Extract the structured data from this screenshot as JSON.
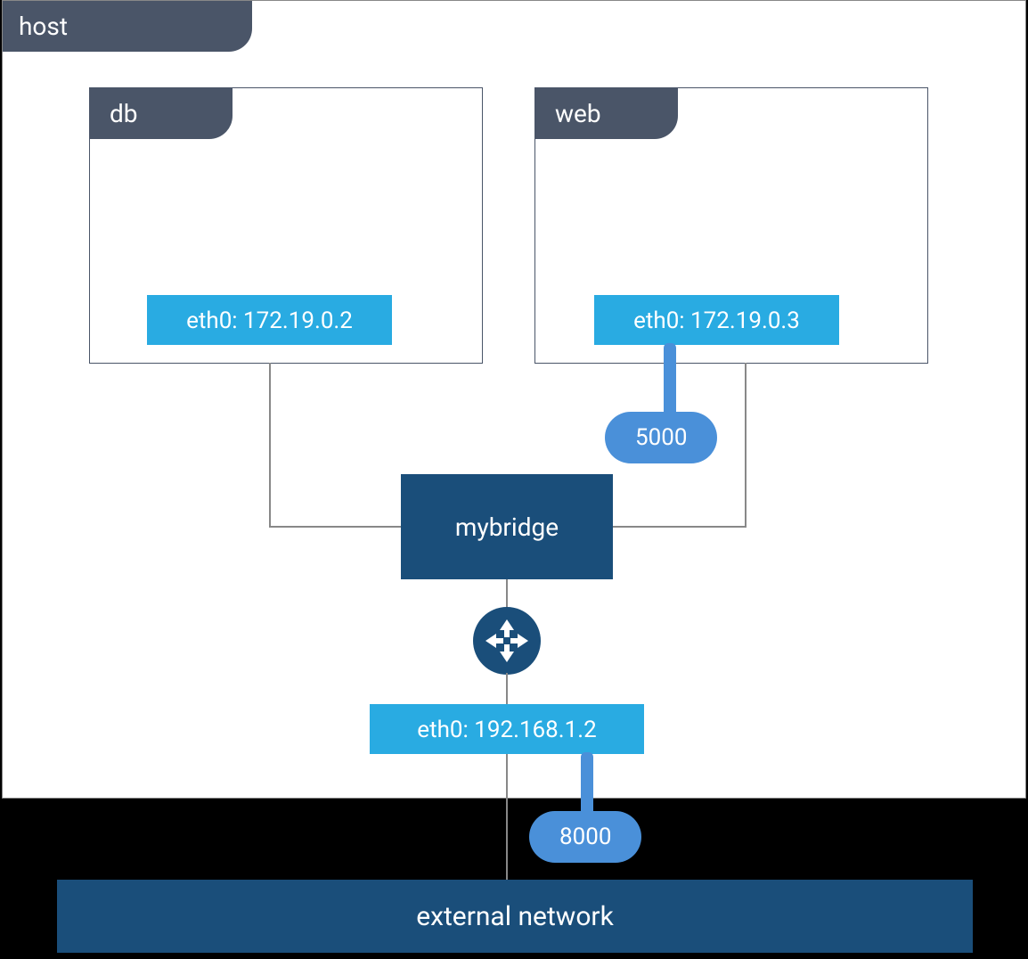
{
  "host": {
    "label": "host",
    "containers": {
      "db": {
        "label": "db",
        "interface": "eth0: 172.19.0.2"
      },
      "web": {
        "label": "web",
        "interface": "eth0: 172.19.0.3",
        "port": "5000"
      }
    },
    "bridge": "mybridge",
    "interface": "eth0: 192.168.1.2",
    "external_port": "8000"
  },
  "external_network": "external network"
}
